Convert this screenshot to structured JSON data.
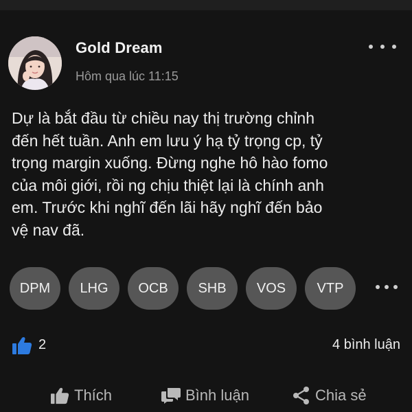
{
  "post": {
    "author": "Gold Dream",
    "timestamp": "Hôm qua lúc 11:15",
    "body_lines": [
      "Dự là bắt đầu từ chiều nay thị trường chỉnh",
      "đến hết tuần. Anh em lưu ý hạ tỷ trọng cp, tỷ",
      "trọng margin xuống. Đừng nghe hô hào fomo",
      "của môi giới, rồi ng chịu thiệt lại là chính anh",
      "em. Trước khi nghĩ đến lãi hãy nghĩ đến bảo",
      "vệ nav đã."
    ],
    "tags": [
      "DPM",
      "LHG",
      "OCB",
      "SHB",
      "VOS",
      "VTP"
    ]
  },
  "stats": {
    "likes": "2",
    "comments": "4 bình luận"
  },
  "actions": {
    "like": "Thích",
    "comment": "Bình luận",
    "share": "Chia sẻ"
  },
  "icons": {
    "like_reaction": "thumbs-up-icon",
    "more_options": "more-horizontal-icon"
  },
  "colors": {
    "like_blue": "#2d7be0",
    "tag_bg": "#565656",
    "card_bg": "#141414"
  }
}
